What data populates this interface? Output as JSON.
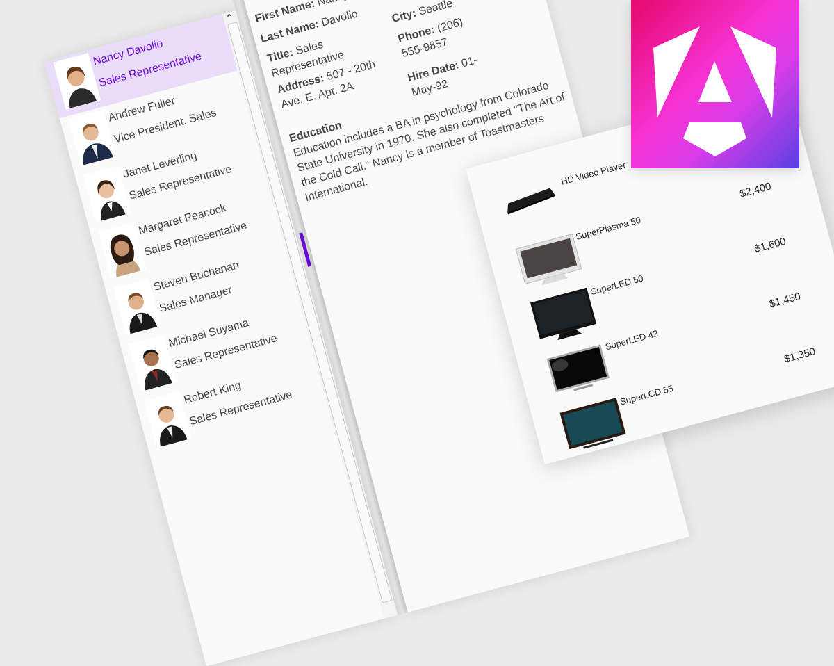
{
  "employees": [
    {
      "name": "Nancy Davolio",
      "title": "Sales Representative",
      "selected": true
    },
    {
      "name": "Andrew Fuller",
      "title": "Vice President, Sales"
    },
    {
      "name": "Janet Leverling",
      "title": "Sales Representative"
    },
    {
      "name": "Margaret Peacock",
      "title": "Sales Representative"
    },
    {
      "name": "Steven Buchanan",
      "title": "Sales Manager"
    },
    {
      "name": "Michael Suyama",
      "title": "Sales Representative"
    },
    {
      "name": "Robert King",
      "title": "Sales Representative"
    }
  ],
  "scrollbar": {
    "up_icon": "chevron-up-icon"
  },
  "detail": {
    "first_name_label": "First Name:",
    "first_name": "Nancy",
    "last_name_label": "Last Name:",
    "last_name": "Davolio",
    "title_label": "Title:",
    "title": "Sales Representative",
    "address_label": "Address:",
    "address": "507 - 20th Ave. E. Apt. 2A",
    "city_label": "City:",
    "city": "Seattle",
    "phone_label": "Phone:",
    "phone": "(206) 555-9857",
    "hire_date_label": "Hire Date:",
    "hire_date": "01-May-92",
    "education_label": "Education",
    "education": "Education includes a BA in psychology from Colorado State University in 1970. She also completed \"The Art of the Cold Call.\" Nancy is a member of Toastmasters International."
  },
  "products": [
    {
      "name": "HD Video Player",
      "price": "$2,400"
    },
    {
      "name": "SuperPlasma 50",
      "price": "$1,600"
    },
    {
      "name": "SuperLED 50",
      "price": "$1,450"
    },
    {
      "name": "SuperLED 42",
      "price": "$1,350"
    },
    {
      "name": "SuperLCD 55"
    }
  ],
  "colors": {
    "accent": "#6e0bd9",
    "selected_bg": "#e9dcf8",
    "logo_start": "#e6086c",
    "logo_end": "#5a40e2"
  },
  "logo": {
    "icon": "angular-logo-icon",
    "text": "A"
  }
}
